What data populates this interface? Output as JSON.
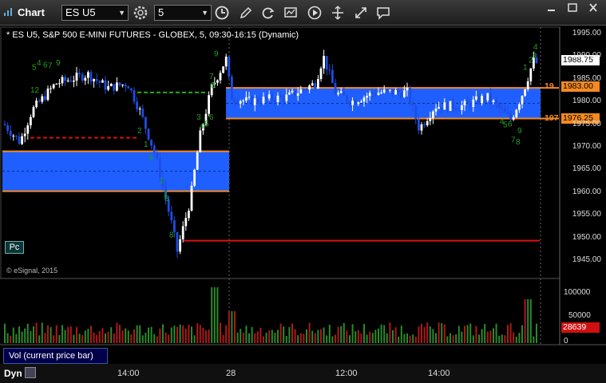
{
  "window": {
    "title": "Chart"
  },
  "toolbar": {
    "symbol": "ES U5",
    "interval": "5",
    "icons": [
      "settings-gear-icon",
      "clock-icon",
      "pencil-draw-icon",
      "refresh-cycle-icon",
      "study-icon",
      "play-icon",
      "drag-icon",
      "zoom-icon",
      "callout-icon"
    ]
  },
  "window_controls": [
    "minimize-icon",
    "maximize-icon",
    "close-icon"
  ],
  "chart": {
    "symbol_title": "* ES U5, S&P 500 E-MINI FUTURES - GLOBEX, 5, 09:30-16:15 (Dynamic)",
    "copyright": "© eSignal, 2015",
    "pc_label": "Pc",
    "price_axis_ticks": [
      "1995.00",
      "1990.00",
      "1985.00",
      "1980.00",
      "1975.00",
      "1970.00",
      "1965.00",
      "1960.00",
      "1955.00",
      "1950.00",
      "1945.00"
    ],
    "last_price": "1988.75",
    "levels": [
      {
        "side_label": "19",
        "value": "1983.00",
        "color": "#f58a20"
      },
      {
        "side_label": "197",
        "value": "1976.25",
        "color": "#f58a20"
      }
    ],
    "volume_axis_ticks": [
      "100000",
      "50000",
      "0"
    ],
    "volume_last": "28639",
    "volume_tab": "Vol (current price bar)",
    "time_labels": [
      "14:00",
      "28",
      "12:00",
      "14:00"
    ],
    "mode_label": "Dyn",
    "colors": {
      "up_bar": "#ffffff",
      "down_bar": "#1e4de0",
      "zone": "#1f5fff",
      "zone_line": "#f58a20",
      "vol_up": "#2a8a2a",
      "vol_down": "#b01818",
      "support_red": "#e01010",
      "dash_green": "#20b020",
      "dash_red": "#d01010"
    },
    "counts": [
      {
        "t": "4"
      },
      {
        "t": "5"
      },
      {
        "t": "6"
      },
      {
        "t": "7"
      },
      {
        "t": "9"
      },
      {
        "t": "12"
      },
      {
        "t": "2"
      },
      {
        "t": "1"
      },
      {
        "t": "2"
      },
      {
        "t": "7"
      },
      {
        "t": "8"
      },
      {
        "t": "8"
      },
      {
        "t": "9"
      },
      {
        "t": "3"
      },
      {
        "t": "4"
      },
      {
        "t": "5"
      },
      {
        "t": "6"
      },
      {
        "t": "9"
      },
      {
        "t": "7"
      },
      {
        "t": "8"
      },
      {
        "t": "4"
      },
      {
        "t": "5"
      },
      {
        "t": "6"
      },
      {
        "t": "7"
      },
      {
        "t": "8"
      },
      {
        "t": "9"
      },
      {
        "t": "1"
      },
      {
        "t": "2"
      },
      {
        "t": "3"
      },
      {
        "t": "4"
      }
    ]
  }
}
